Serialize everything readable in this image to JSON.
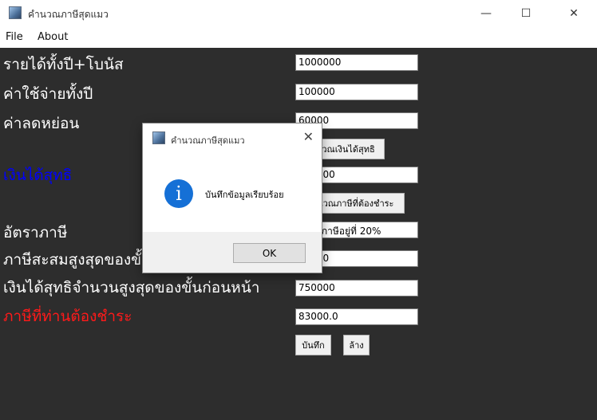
{
  "window": {
    "title": "คำนวณภาษีสุดแมว",
    "minimize_glyph": "—",
    "maximize_glyph": "☐",
    "close_glyph": "✕"
  },
  "menu": [
    "File",
    "About"
  ],
  "form": {
    "rows": [
      {
        "label": "รายได้ทั้งปี+โบนัส",
        "value": "1000000"
      },
      {
        "label": "ค่าใช้จ่ายทั้งปี",
        "value": "100000"
      },
      {
        "label": "ค่าลดหย่อน",
        "value": "60000"
      },
      {
        "label": "เงินได้สุทธิ",
        "value": "840000"
      },
      {
        "label": "อัตราภาษี",
        "value": "อัตราภาษีอยู่ที่ 20%"
      },
      {
        "label": "ภาษีสะสมสูงสุดของขั้นก่อนหน้า",
        "value": "65000"
      },
      {
        "label": "เงินได้สุทธิจำนวนสูงสุดของขั้นก่อนหน้า",
        "value": "750000"
      },
      {
        "label": "ภาษีที่ท่านต้องชำระ",
        "value": "83000.0"
      }
    ],
    "buttons": {
      "calc_net": "คำนวณเงินได้สุทธิ",
      "calc_tax": "คำนวณภาษีที่ต้องชำระ",
      "save": "บันทึก",
      "clear": "ล้าง"
    }
  },
  "dialog": {
    "title": "คำนวณภาษีสุดแมว",
    "message": "บันทึกข้อมูลเรียบร้อย",
    "ok": "OK",
    "icon": "info-icon"
  }
}
